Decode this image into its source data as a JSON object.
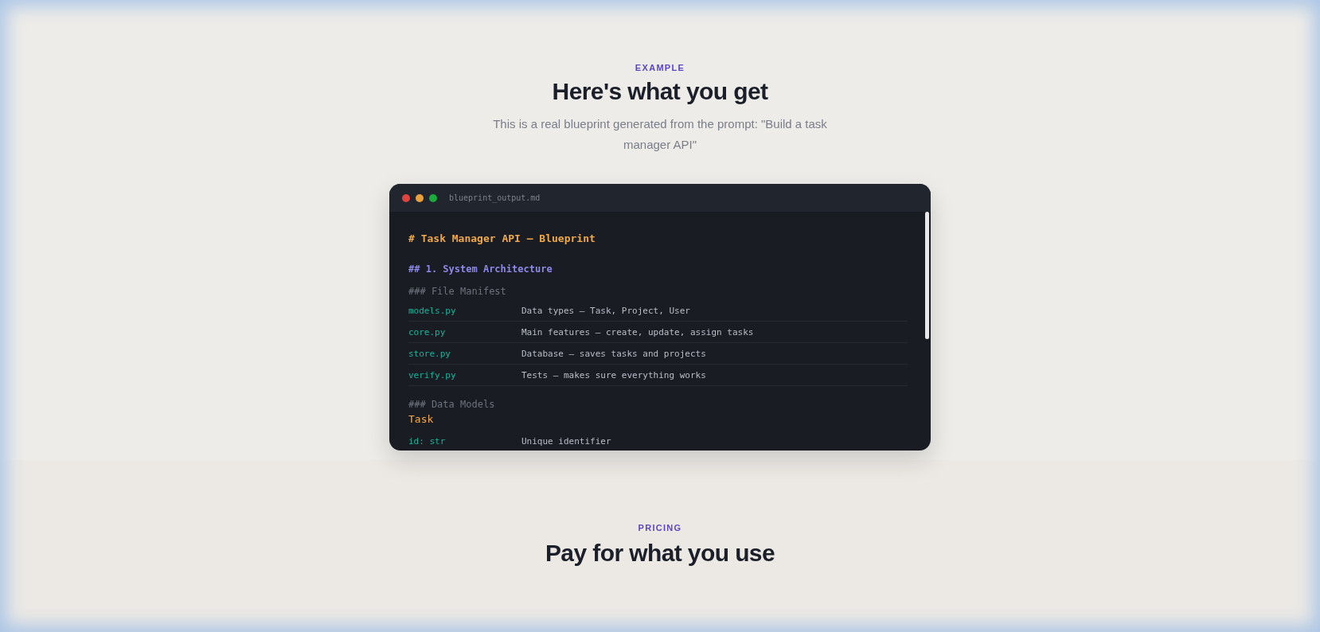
{
  "example_section": {
    "eyebrow": "EXAMPLE",
    "title": "Here's what you get",
    "subtitle": "This is a real blueprint generated from the prompt: \"Build a task manager API\""
  },
  "code_window": {
    "filename": "blueprint_output.md",
    "dots": [
      {
        "color": "#e0443e"
      },
      {
        "color": "#e9a23b"
      },
      {
        "color": "#1aab3c"
      }
    ],
    "lines": [
      {
        "kind": "h1",
        "text": "# Task Manager API — Blueprint"
      },
      {
        "kind": "h2",
        "text": "## 1. System Architecture"
      },
      {
        "kind": "h3",
        "text": "### File Manifest"
      },
      {
        "kind": "row",
        "key": "models.py",
        "value": "Data types — Task, Project, User"
      },
      {
        "kind": "row",
        "key": "core.py",
        "value": "Main features — create, update, assign tasks"
      },
      {
        "kind": "row",
        "key": "store.py",
        "value": "Database — saves tasks and projects"
      },
      {
        "kind": "row",
        "key": "verify.py",
        "value": "Tests — makes sure everything works"
      },
      {
        "kind": "h3",
        "text": "### Data Models"
      },
      {
        "kind": "model",
        "text": "Task"
      },
      {
        "kind": "field",
        "key": "id: str",
        "value": "Unique identifier"
      }
    ]
  },
  "pricing_section": {
    "eyebrow": "PRICING",
    "title": "Pay for what you use"
  }
}
